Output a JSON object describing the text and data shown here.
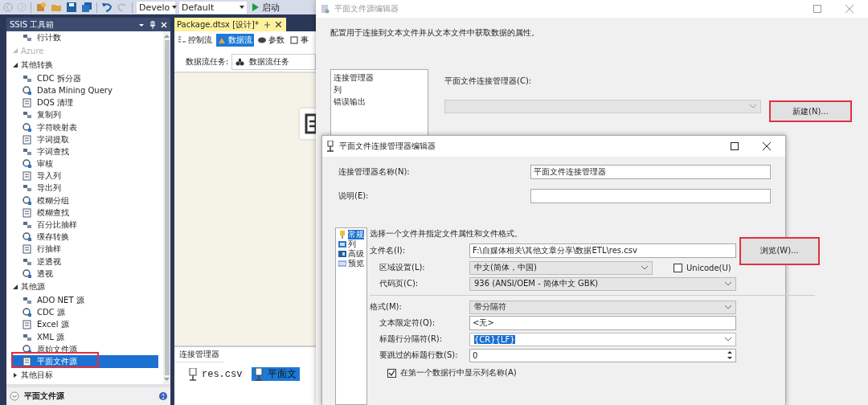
{
  "toolbar": {
    "configuration": "Develo",
    "platform": "Default",
    "start_label": "启动"
  },
  "toolbox": {
    "title": "SSIS 工具箱",
    "items": [
      {
        "kind": "item",
        "label": "行计数",
        "selected": false,
        "highlighted": false
      },
      {
        "kind": "group",
        "label": "Azure",
        "expanded": true,
        "disabled": true
      },
      {
        "kind": "group",
        "label": "其他转换",
        "expanded": true,
        "disabled": false,
        "children": [
          {
            "kind": "item",
            "label": "CDC 拆分器",
            "selected": false,
            "highlighted": false
          },
          {
            "kind": "item",
            "label": "Data Mining Query",
            "selected": false,
            "highlighted": false
          },
          {
            "kind": "item",
            "label": "DQS 清理",
            "selected": false,
            "highlighted": false
          },
          {
            "kind": "item",
            "label": "复制列",
            "selected": false,
            "highlighted": false
          },
          {
            "kind": "item",
            "label": "字符映射表",
            "selected": false,
            "highlighted": false
          },
          {
            "kind": "item",
            "label": "字词提取",
            "selected": false,
            "highlighted": false
          },
          {
            "kind": "item",
            "label": "字词查找",
            "selected": false,
            "highlighted": false
          },
          {
            "kind": "item",
            "label": "审核",
            "selected": false,
            "highlighted": false
          },
          {
            "kind": "item",
            "label": "导入列",
            "selected": false,
            "highlighted": false
          },
          {
            "kind": "item",
            "label": "导出列",
            "selected": false,
            "highlighted": false
          },
          {
            "kind": "item",
            "label": "模糊分组",
            "selected": false,
            "highlighted": false
          },
          {
            "kind": "item",
            "label": "模糊查找",
            "selected": false,
            "highlighted": false
          },
          {
            "kind": "item",
            "label": "百分比抽样",
            "selected": false,
            "highlighted": false
          },
          {
            "kind": "item",
            "label": "缓存转换",
            "selected": false,
            "highlighted": false
          },
          {
            "kind": "item",
            "label": "行抽样",
            "selected": false,
            "highlighted": false
          },
          {
            "kind": "item",
            "label": "逆透视",
            "selected": false,
            "highlighted": false
          },
          {
            "kind": "item",
            "label": "透视",
            "selected": false,
            "highlighted": false
          }
        ]
      },
      {
        "kind": "group",
        "label": "其他源",
        "expanded": true,
        "disabled": false,
        "children": [
          {
            "kind": "item",
            "label": "ADO NET 源",
            "selected": false,
            "highlighted": false
          },
          {
            "kind": "item",
            "label": "CDC 源",
            "selected": false,
            "highlighted": false
          },
          {
            "kind": "item",
            "label": "Excel 源",
            "selected": false,
            "highlighted": false
          },
          {
            "kind": "item",
            "label": "XML 源",
            "selected": false,
            "highlighted": false
          },
          {
            "kind": "item",
            "label": "原始文件源",
            "selected": false,
            "highlighted": false
          },
          {
            "kind": "item",
            "label": "平面文件源",
            "selected": true,
            "highlighted": true
          }
        ]
      },
      {
        "kind": "group",
        "label": "其他目标",
        "expanded": false,
        "disabled": false
      }
    ],
    "description_title": "平面文件源"
  },
  "designer": {
    "document_tab": "Package.dtsx [设计]*",
    "tabs": [
      {
        "label": "控制流",
        "selected": false
      },
      {
        "label": "数据流",
        "selected": true
      },
      {
        "label": "参数",
        "selected": false
      },
      {
        "label": "事",
        "selected": false
      }
    ],
    "task_label": "数据流任务:",
    "task_value": "数据流任务",
    "connection_managers": {
      "title": "连接管理器",
      "items": [
        {
          "label": "res.csv",
          "selected": false
        },
        {
          "label": "平面文",
          "selected": true
        }
      ]
    }
  },
  "source_editor": {
    "title": "平面文件源编辑器",
    "description": "配置用于连接到文本文件并从文本文件中获取数据的属性。",
    "pages": [
      {
        "label": "连接管理器",
        "selected": false
      },
      {
        "label": "列",
        "selected": false
      },
      {
        "label": "错误输出",
        "selected": false
      }
    ],
    "connection_label": "平面文件连接管理器(C):",
    "new_button": {
      "label": "新建(N)...",
      "highlighted": true
    }
  },
  "connection_editor": {
    "title": "平面文件连接管理器编辑器",
    "name_label": "连接管理器名称(N):",
    "name_value": "平面文件连接管理器",
    "description_label": "说明(E):",
    "pages": [
      {
        "label": "常规",
        "selected": true
      },
      {
        "label": "列",
        "selected": false
      },
      {
        "label": "高级",
        "selected": false
      },
      {
        "label": "预览",
        "selected": false
      }
    ],
    "instruction": "选择一个文件并指定文件属性和文件格式。",
    "file": {
      "label": "文件名(I):",
      "value": "F:\\自媒体相关\\其他文章分享\\数据ETL\\res.csv",
      "browse_button": {
        "label": "浏览(W)...",
        "highlighted": true
      }
    },
    "locale": {
      "label": "区域设置(L):",
      "value": "中文(简体，中国)"
    },
    "unicode": {
      "label": "Unicode(U)",
      "checked": false
    },
    "code_page": {
      "label": "代码页(C):",
      "value": "936   (ANSI/OEM - 简体中文 GBK)"
    },
    "format": {
      "label": "格式(M):",
      "value": "带分隔符"
    },
    "text_qualifier": {
      "label": "文本限定符(Q):",
      "value": "<无>"
    },
    "header_delimiter": {
      "label": "标题行分隔符(R):",
      "value": "{CR}{LF}",
      "text_selected": true
    },
    "header_rows_to_skip": {
      "label": "要跳过的标题行数(S):",
      "value": "0"
    },
    "column_names_checkbox": {
      "label": "在第一个数据行中显示列名称(A)",
      "checked": true
    }
  }
}
